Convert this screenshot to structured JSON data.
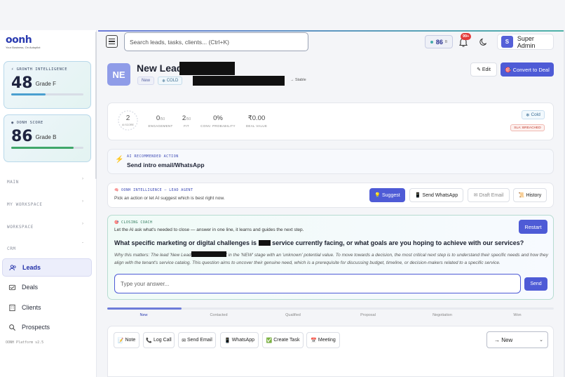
{
  "brand": {
    "logo": "oonh",
    "tagline": "Your Business, On Autopilot"
  },
  "sidebar": {
    "growth": {
      "label": "GROWTH INTELLIGENCE",
      "score": "48",
      "grade": "Grade F",
      "progress": 0.48
    },
    "oonh": {
      "label": "OONH SCORE",
      "score": "86",
      "grade": "Grade B",
      "progress": 0.86
    },
    "sections": [
      "MAIN",
      "MY WORKSPACE",
      "WORKSPACE",
      "CRM"
    ],
    "items": [
      {
        "label": "Leads",
        "icon": "users-icon"
      },
      {
        "label": "Deals",
        "icon": "handshake-icon"
      },
      {
        "label": "Clients",
        "icon": "building-icon"
      },
      {
        "label": "Prospects",
        "icon": "search-icon"
      }
    ],
    "version": "OONH Platform v2.5"
  },
  "header": {
    "search_placeholder": "Search leads, tasks, clients... (Ctrl+K)",
    "score": "86",
    "score_suffix": "B",
    "notifications": "99+",
    "user_initial": "S",
    "user_name": "Super Admin"
  },
  "lead": {
    "initials": "NE",
    "name": "New Lead",
    "status": "New",
    "temperature": "COLD",
    "trend": "→ Stable",
    "edit": "Edit",
    "convert": "Convert to Deal"
  },
  "stats": {
    "ai_score": "2",
    "ai_score_label": "AI SCORE",
    "items": [
      {
        "value": "0",
        "suffix": "/50",
        "label": "ENGAGEMENT"
      },
      {
        "value": "2",
        "suffix": "/50",
        "label": "FIT"
      },
      {
        "value": "0%",
        "suffix": "",
        "label": "CONV. PROBABILITY"
      },
      {
        "value": "₹0.00",
        "suffix": "",
        "label": "DEAL VALUE"
      }
    ],
    "temp_chip": "Cold",
    "sla": "SLA: BREACHED"
  },
  "recommended": {
    "label": "AI RECOMMENDED ACTION",
    "text": "Send intro email/WhatsApp"
  },
  "agent": {
    "label": "OONH INTELLIGENCE — LEAD AGENT",
    "subtitle": "Pick an action or let AI suggest which is best right now.",
    "buttons": [
      "Suggest",
      "Send WhatsApp",
      "Draft Email",
      "History"
    ]
  },
  "coach": {
    "label": "CLOSING COACH",
    "subtitle": "Let the AI ask what's needed to close — answer in one line, it learns and guides the next step.",
    "restart": "Restart",
    "question_a": "What specific marketing or digital challenges is",
    "question_b": "service currently facing, or what goals are you hoping to achieve with our services?",
    "why_a": "Why this matters: The lead 'New Lead",
    "why_b": "' in the 'NEW' stage with an 'unknown' potential value. To move towards a decision, the most critical next step is to understand their specific needs and how they align with the tenant's service catalog. This question aims to uncover their genuine need, which is a prerequisite for discussing budget, timeline, or decision-makers related to a specific service.",
    "answer_placeholder": "Type your answer...",
    "send": "Send"
  },
  "pipeline": {
    "stages": [
      "New",
      "Contacted",
      "Qualified",
      "Proposal",
      "Negotiation",
      "Won"
    ],
    "current": 0
  },
  "actions": [
    "Note",
    "Log Call",
    "Send Email",
    "WhatsApp",
    "Create Task",
    "Meeting"
  ],
  "stage_select": "→ New"
}
